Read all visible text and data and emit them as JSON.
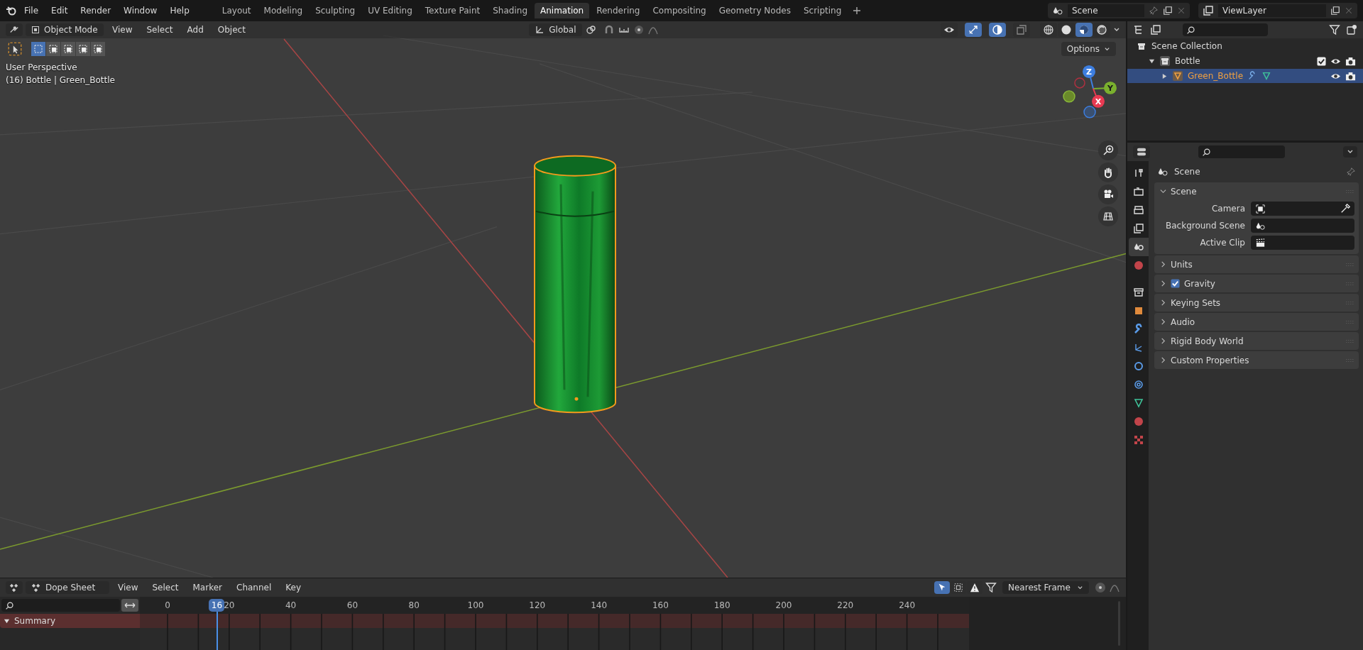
{
  "top_bar": {
    "menus": [
      "File",
      "Edit",
      "Render",
      "Window",
      "Help"
    ],
    "workspaces": [
      {
        "label": "Layout",
        "selected": false
      },
      {
        "label": "Modeling",
        "selected": false
      },
      {
        "label": "Sculpting",
        "selected": false
      },
      {
        "label": "UV Editing",
        "selected": false
      },
      {
        "label": "Texture Paint",
        "selected": false
      },
      {
        "label": "Shading",
        "selected": false
      },
      {
        "label": "Animation",
        "selected": true
      },
      {
        "label": "Rendering",
        "selected": false
      },
      {
        "label": "Compositing",
        "selected": false
      },
      {
        "label": "Geometry Nodes",
        "selected": false
      },
      {
        "label": "Scripting",
        "selected": false
      }
    ],
    "scene": "Scene",
    "view_layer": "ViewLayer"
  },
  "viewport": {
    "mode": "Object Mode",
    "menus": [
      "View",
      "Select",
      "Add",
      "Object"
    ],
    "orientation": "Global",
    "toggles": [
      {
        "kind": "visibility",
        "on": false
      },
      {
        "kind": "gizmos",
        "on": true
      },
      {
        "kind": "overlays",
        "on": true
      },
      {
        "kind": "xray",
        "on": false
      }
    ],
    "shading_modes": [
      {
        "kind": "wireframe",
        "selected": false
      },
      {
        "kind": "solid",
        "selected": false
      },
      {
        "kind": "material",
        "selected": true
      },
      {
        "kind": "rendered",
        "selected": false
      }
    ],
    "select_modes": [
      {
        "selected": true
      },
      {
        "selected": false
      },
      {
        "selected": false
      },
      {
        "selected": false
      },
      {
        "selected": false
      }
    ],
    "options": "Options",
    "info": [
      "User Perspective",
      "(16) Bottle | Green_Bottle"
    ],
    "gizmo": {
      "z": "Z",
      "y": "Y",
      "x": "X"
    }
  },
  "outliner": {
    "items": [
      {
        "label": "Scene Collection",
        "kind": "collection",
        "selected": false,
        "children": [
          {
            "label": "Bottle",
            "kind": "collection",
            "expanded": true,
            "selected": false,
            "checked": true,
            "children": [
              {
                "label": "Green_Bottle",
                "kind": "object",
                "expanded": false,
                "selected": true
              }
            ]
          }
        ]
      }
    ]
  },
  "properties": {
    "tabs": [
      {
        "kind": "tool",
        "selected": false
      },
      {
        "kind": "render",
        "selected": false
      },
      {
        "kind": "output",
        "selected": false
      },
      {
        "kind": "view_layer",
        "selected": false
      },
      {
        "kind": "scene",
        "selected": true
      },
      {
        "kind": "world",
        "selected": false
      },
      {
        "kind": "collection",
        "selected": false
      },
      {
        "kind": "object",
        "selected": false
      },
      {
        "kind": "modifiers",
        "selected": false
      },
      {
        "kind": "particles",
        "selected": false
      },
      {
        "kind": "physics",
        "selected": false
      },
      {
        "kind": "constraints",
        "selected": false
      },
      {
        "kind": "data",
        "selected": false
      },
      {
        "kind": "material",
        "selected": false
      },
      {
        "kind": "texture",
        "selected": false
      }
    ],
    "title": "Scene",
    "panels": [
      {
        "title": "Scene",
        "expanded": true,
        "fields": [
          {
            "label": "Camera",
            "kind": "camera"
          },
          {
            "label": "Background Scene",
            "kind": "scene"
          },
          {
            "label": "Active Clip",
            "kind": "clip"
          }
        ]
      },
      {
        "title": "Units",
        "expanded": false
      },
      {
        "title": "Gravity",
        "expanded": false,
        "checked": true
      },
      {
        "title": "Keying Sets",
        "expanded": false
      },
      {
        "title": "Audio",
        "expanded": false
      },
      {
        "title": "Rigid Body World",
        "expanded": false
      },
      {
        "title": "Custom Properties",
        "expanded": false
      }
    ]
  },
  "timeline": {
    "editor": "Dope Sheet",
    "menus": [
      "View",
      "Select",
      "Marker",
      "Channel",
      "Key"
    ],
    "toggles": [
      {
        "kind": "only_selected",
        "on": true
      },
      {
        "kind": "hidden",
        "on": false
      },
      {
        "kind": "errors",
        "on": false
      }
    ],
    "snapping": "Nearest Frame",
    "current_frame": "16",
    "frames": [
      "0",
      "20",
      "40",
      "60",
      "80",
      "100",
      "120",
      "140",
      "160",
      "180",
      "200",
      "220",
      "240"
    ],
    "channels": [
      {
        "name": "Summary",
        "expanded": true
      }
    ]
  }
}
